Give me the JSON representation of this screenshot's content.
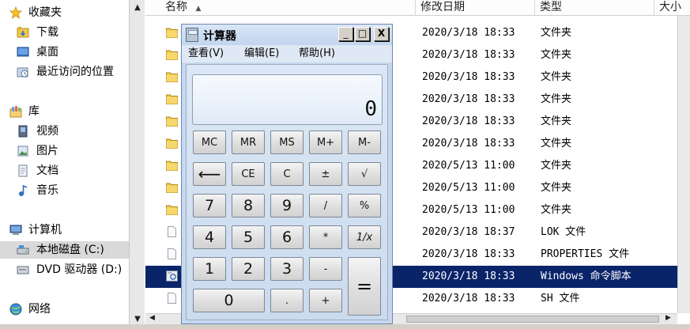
{
  "nav": {
    "favorites": "收藏夹",
    "downloads": "下载",
    "desktop": "桌面",
    "recent": "最近访问的位置",
    "libraries": "库",
    "videos": "视频",
    "pictures": "图片",
    "documents": "文档",
    "music": "音乐",
    "computer": "计算机",
    "local_disk": "本地磁盘 (C:)",
    "dvd": "DVD 驱动器 (D:)",
    "network": "网络"
  },
  "columns": {
    "name": "名称",
    "modified": "修改日期",
    "type": "类型",
    "size": "大小"
  },
  "files": [
    {
      "modified": "2020/3/18 18:33",
      "type": "文件夹",
      "icon": "folder-icon"
    },
    {
      "modified": "2020/3/18 18:33",
      "type": "文件夹",
      "icon": "folder-icon"
    },
    {
      "modified": "2020/3/18 18:33",
      "type": "文件夹",
      "icon": "folder-icon"
    },
    {
      "modified": "2020/3/18 18:33",
      "type": "文件夹",
      "icon": "folder-icon"
    },
    {
      "modified": "2020/3/18 18:33",
      "type": "文件夹",
      "icon": "folder-icon"
    },
    {
      "modified": "2020/3/18 18:33",
      "type": "文件夹",
      "icon": "folder-icon"
    },
    {
      "modified": "2020/5/13 11:00",
      "type": "文件夹",
      "icon": "folder-icon"
    },
    {
      "modified": "2020/5/13 11:00",
      "type": "文件夹",
      "icon": "folder-icon"
    },
    {
      "modified": "2020/5/13 11:00",
      "type": "文件夹",
      "icon": "folder-icon"
    },
    {
      "modified": "2020/3/18 18:37",
      "type": "LOK 文件",
      "icon": "file-icon"
    },
    {
      "modified": "2020/3/18 18:33",
      "type": "PROPERTIES 文件",
      "icon": "file-icon"
    },
    {
      "modified": "2020/3/18 18:33",
      "type": "Windows 命令脚本",
      "icon": "script-icon",
      "selected": true
    },
    {
      "modified": "2020/3/18 18:33",
      "type": "SH 文件",
      "icon": "file-icon"
    }
  ],
  "calculator": {
    "title": "计算器",
    "menu": [
      "查看(V)",
      "编辑(E)",
      "帮助(H)"
    ],
    "display": "0",
    "title_buttons": {
      "minimize": "_",
      "maximize": "□",
      "close": "X"
    },
    "keys": {
      "mc": "MC",
      "mr": "MR",
      "ms": "MS",
      "mplus": "M+",
      "mminus": "M-",
      "back": "⟵",
      "ce": "CE",
      "c": "C",
      "pm": "±",
      "sqrt": "√",
      "k7": "7",
      "k8": "8",
      "k9": "9",
      "div": "/",
      "pct": "%",
      "k4": "4",
      "k5": "5",
      "k6": "6",
      "mul": "*",
      "recip": "1/x",
      "k1": "1",
      "k2": "2",
      "k3": "3",
      "sub": "-",
      "eq": "=",
      "k0": "0",
      "dot": ".",
      "add": "+"
    }
  },
  "colors": {
    "selection": "#0a246a",
    "calc_frame": "#c7d8ee"
  }
}
